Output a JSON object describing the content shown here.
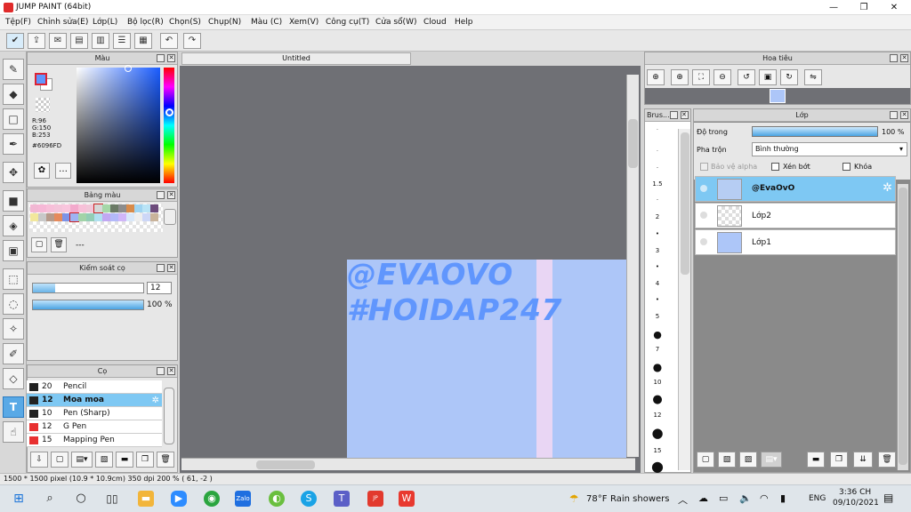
{
  "app": {
    "title": "JUMP PAINT (64bit)",
    "win_min": "—",
    "win_max": "❐",
    "win_close": "✕"
  },
  "menu": [
    "Tệp(F)",
    "Chỉnh sửa(E)",
    "Lớp(L)",
    "Bộ lọc(R)",
    "Chọn(S)",
    "Chụp(N)",
    "Màu (C)",
    "Xem(V)",
    "Công cụ(T)",
    "Cửa sổ(W)",
    "Cloud",
    "Help"
  ],
  "color_panel": {
    "title": "Màu",
    "r": "R:96",
    "g": "G:150",
    "b": "B:253",
    "hex": "#6096FD",
    "current": "#6096fd"
  },
  "palette_panel": {
    "title": "Bảng màu",
    "dash": "---",
    "colors": [
      "#f2b7d3",
      "#f6b7d6",
      "#f7bfd9",
      "#f4c4da",
      "#f9c5dd",
      "#f3a9cc",
      "#f7c0d8",
      "#f1c6d8",
      "#d7d7d7",
      "#a5d7a7",
      "#6b7a66",
      "#8c8c8c",
      "#d88b4a",
      "#9fd4f1",
      "#b9e4f6",
      "#6d4b7c",
      "#f2e79c",
      "#c8c8c8",
      "#b69a8a",
      "#e68a5c",
      "#7d93e8",
      "#9fb3f2",
      "#a2d3a8",
      "#92cdb5",
      "#b0e0f0",
      "#c1a8f2",
      "#b3b9f9",
      "#d0b6f8",
      "#d9e8f9",
      "#eeeeee",
      "#cdd7f7",
      "#c9b39b"
    ]
  },
  "brush_control": {
    "title": "Kiểm soát cọ",
    "size_value": "12",
    "opacity_value": "100 %",
    "size_fraction": 0.2,
    "opacity_fraction": 1.0
  },
  "brushes_panel": {
    "title": "Cọ",
    "items": [
      {
        "size": "20",
        "name": "Pencil",
        "color": "#222222"
      },
      {
        "size": "12",
        "name": "Moa moa",
        "color": "#222222"
      },
      {
        "size": "10",
        "name": "Pen (Sharp)",
        "color": "#222222"
      },
      {
        "size": "12",
        "name": "G Pen",
        "color": "#e83030"
      },
      {
        "size": "15",
        "name": "Mapping Pen",
        "color": "#e83030"
      }
    ]
  },
  "canvas": {
    "tab": "Untitled",
    "line1": "@EVAOVO",
    "line2": "#HOIDAP247"
  },
  "navigator": {
    "title": "Hoa tiêu"
  },
  "brush_sizes": {
    "title": "Brus...",
    "sizes": [
      "1",
      "1.5",
      "2",
      "3",
      "4",
      "5",
      "7",
      "10",
      "12",
      "15"
    ]
  },
  "layers": {
    "title": "Lớp",
    "opacity_label": "Độ trong",
    "opacity_value": "100 %",
    "blend_label": "Pha trộn",
    "blend_value": "Bình thường",
    "protect_alpha": "Bảo vệ alpha",
    "clip": "Xén bớt",
    "lock": "Khóa",
    "items": [
      "@EvaOvO",
      "Lớp2",
      "Lớp1"
    ]
  },
  "status": {
    "text": "1500 * 1500 pixel   (10.9 * 10.9cm)   350 dpi   200 %   ( 61, -2 )"
  },
  "taskbar": {
    "weather_temp": "78°F",
    "weather_text": "Rain showers",
    "lang": "ENG",
    "time": "3:36 CH",
    "date": "09/10/2021"
  }
}
